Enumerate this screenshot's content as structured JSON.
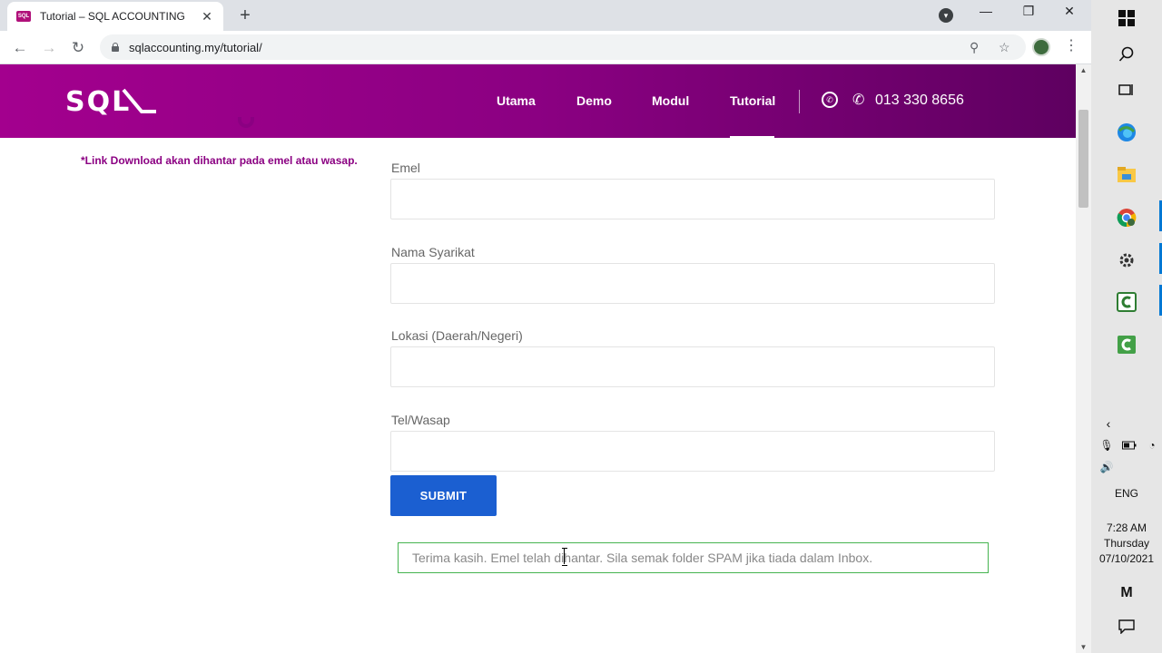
{
  "browser": {
    "tab_title": "Tutorial – SQL ACCOUNTING",
    "tab_favicon": "SQL",
    "url": "sqlaccounting.my/tutorial/"
  },
  "site": {
    "logo": "SQL",
    "nav": [
      "Utama",
      "Demo",
      "Modul",
      "Tutorial"
    ],
    "active_nav": "Tutorial",
    "phone": "013 330 8656",
    "brand_colors": {
      "primary": "#a3008e",
      "dark": "#5e0060",
      "button": "#1b5fd1",
      "success_border": "#46b450"
    }
  },
  "form": {
    "note": "*Link Download akan dihantar pada emel atau wasap.",
    "fields": [
      {
        "label": "Emel",
        "value": ""
      },
      {
        "label": "Nama Syarikat",
        "value": ""
      },
      {
        "label": "Lokasi (Daerah/Negeri)",
        "value": ""
      },
      {
        "label": "Tel/Wasap",
        "value": ""
      }
    ],
    "submit_label": "SUBMIT",
    "success_message": "Terima kasih. Emel telah dihantar. Sila semak folder SPAM jika tiada dalam Inbox."
  },
  "taskbar": {
    "language": "ENG",
    "time": "7:28 AM",
    "day": "Thursday",
    "date": "07/10/2021",
    "icons": [
      "windows-icon",
      "search-icon",
      "task-view-icon",
      "edge-icon",
      "file-explorer-icon",
      "chrome-icon",
      "settings-icon",
      "camtasia-icon",
      "camtasia-recorder-icon",
      "show-hidden-icon",
      "microphone-icon",
      "battery-icon",
      "wifi-icon",
      "volume-icon",
      "meet-now-icon",
      "notifications-icon"
    ]
  }
}
